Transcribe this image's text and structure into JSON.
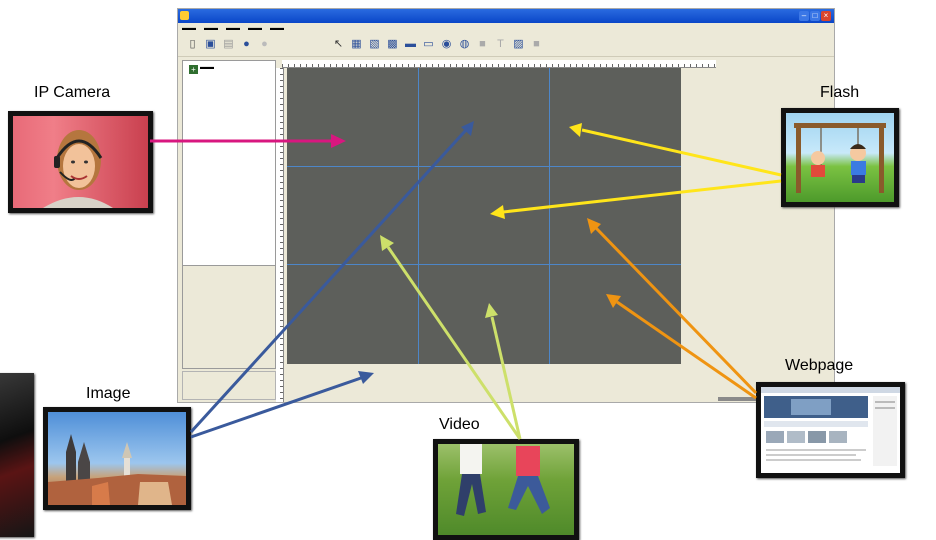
{
  "labels": {
    "ip_camera": "IP Camera",
    "flash": "Flash",
    "image": "Image",
    "video": "Video",
    "webpage": "Webpage"
  },
  "colors": {
    "ip_camera_arrow": "#d8177f",
    "flash_arrow": "#ffe51a",
    "image_arrow": "#3a5a9c",
    "video_arrow": "#cde06a",
    "webpage_arrow": "#ef9412",
    "canvas": "#5d5f5b",
    "grid_line": "#4d86c8"
  }
}
